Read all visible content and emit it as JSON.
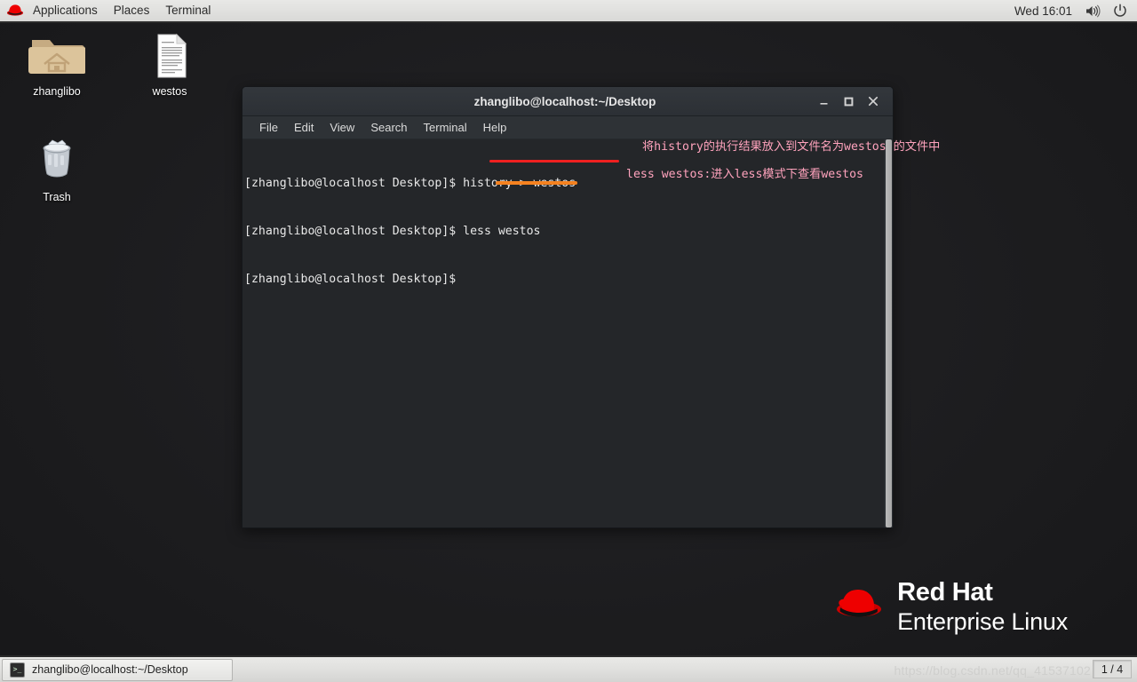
{
  "top_panel": {
    "logo_icon": "redhat-logo-icon",
    "items": [
      {
        "label": "Applications"
      },
      {
        "label": "Places"
      },
      {
        "label": "Terminal"
      }
    ],
    "clock": "Wed 16:01",
    "volume_icon": "volume-icon",
    "power_icon": "power-icon"
  },
  "desktop": {
    "icons": [
      {
        "label": "zhanglibo",
        "icon": "home-folder-icon"
      },
      {
        "label": "westos",
        "icon": "text-document-icon"
      },
      {
        "label": "Trash",
        "icon": "trash-can-icon"
      }
    ]
  },
  "terminal": {
    "title": "zhanglibo@localhost:~/Desktop",
    "window_buttons": {
      "minimize": "_",
      "maximize": "□",
      "close": "✕"
    },
    "menu": [
      {
        "label": "File"
      },
      {
        "label": "Edit"
      },
      {
        "label": "View"
      },
      {
        "label": "Search"
      },
      {
        "label": "Terminal"
      },
      {
        "label": "Help"
      }
    ],
    "prompt": "[zhanglibo@localhost Desktop]$ ",
    "lines": [
      {
        "prompt": "[zhanglibo@localhost Desktop]$ ",
        "command": "history > westos"
      },
      {
        "prompt": "[zhanglibo@localhost Desktop]$ ",
        "command": "less westos"
      },
      {
        "prompt": "[zhanglibo@localhost Desktop]$ ",
        "command": ""
      }
    ]
  },
  "annotations": {
    "line1": "将history的执行结果放入到文件名为westos 的文件中",
    "line2": "less westos:进入less模式下查看westos",
    "text_color": "#ffa3bd",
    "underline_red": "#f02020",
    "underline_orange": "#f58220"
  },
  "branding": {
    "line1": "Red Hat",
    "line2": "Enterprise Linux",
    "logo_icon": "redhat-fedora-icon",
    "logo_color": "#ee0000"
  },
  "bottom_panel": {
    "task_button": {
      "label": "zhanglibo@localhost:~/Desktop",
      "icon": "terminal-icon",
      "icon_glyph": ">_"
    },
    "watermark": "https://blog.csdn.net/qq_41537102",
    "workspace": "1 / 4"
  }
}
